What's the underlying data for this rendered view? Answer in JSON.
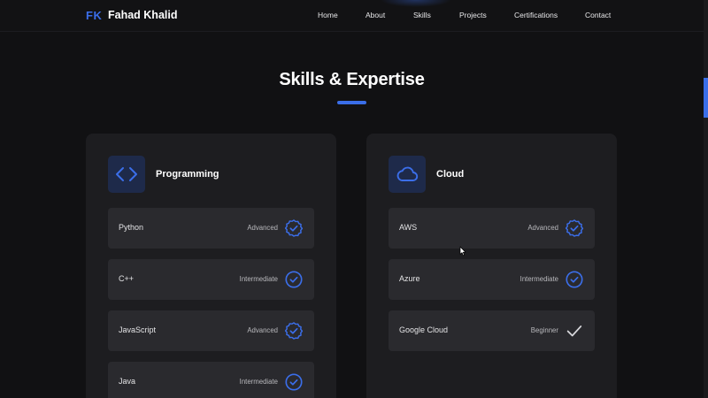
{
  "header": {
    "logo": "FK",
    "name": "Fahad Khalid",
    "nav": [
      "Home",
      "About",
      "Skills",
      "Projects",
      "Certifications",
      "Contact"
    ]
  },
  "section": {
    "title": "Skills & Expertise"
  },
  "cards": [
    {
      "title": "Programming",
      "icon": "code-icon",
      "skills": [
        {
          "name": "Python",
          "level": "Advanced",
          "icon": "badge-check-icon"
        },
        {
          "name": "C++",
          "level": "Intermediate",
          "icon": "circle-check-icon"
        },
        {
          "name": "JavaScript",
          "level": "Advanced",
          "icon": "badge-check-icon"
        },
        {
          "name": "Java",
          "level": "Intermediate",
          "icon": "circle-check-icon"
        }
      ]
    },
    {
      "title": "Cloud",
      "icon": "cloud-icon",
      "skills": [
        {
          "name": "AWS",
          "level": "Advanced",
          "icon": "badge-check-icon"
        },
        {
          "name": "Azure",
          "level": "Intermediate",
          "icon": "circle-check-icon"
        },
        {
          "name": "Google Cloud",
          "level": "Beginner",
          "icon": "check-icon"
        }
      ]
    }
  ],
  "colors": {
    "accent": "#3b6ee9",
    "background": "#111113",
    "card": "#1d1d20",
    "row": "#2a2a2e"
  }
}
